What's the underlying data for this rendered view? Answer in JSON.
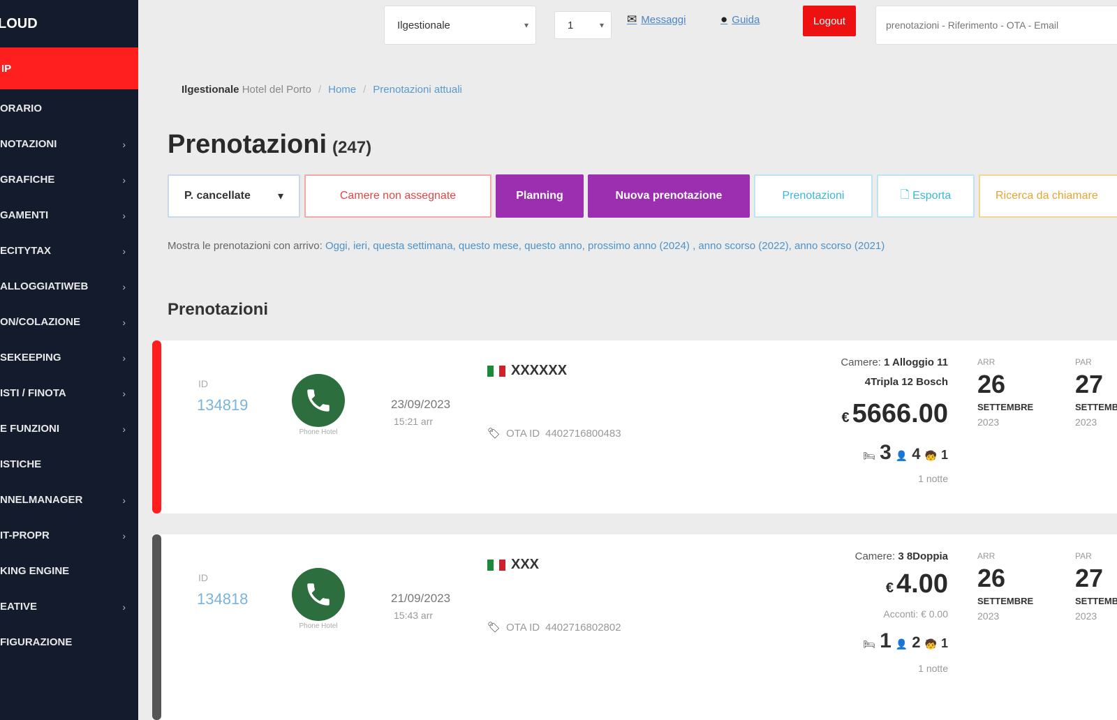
{
  "sidebar": {
    "brand": "LOUD",
    "active_item": "IP",
    "items": [
      {
        "label": "ORARIO",
        "chevron": false
      },
      {
        "label": "NOTAZIONI",
        "chevron": true
      },
      {
        "label": "GRAFICHE",
        "chevron": true
      },
      {
        "label": "GAMENTI",
        "chevron": true
      },
      {
        "label": "ECITYTAX",
        "chevron": true
      },
      {
        "label": "ALLOGGIATIWEB",
        "chevron": true
      },
      {
        "label": "ON/COLAZIONE",
        "chevron": true
      },
      {
        "label": "SEKEEPING",
        "chevron": true
      },
      {
        "label": "ISTI / FINOTA",
        "chevron": true
      },
      {
        "label": "E FUNZIONI",
        "chevron": true
      },
      {
        "label": "ISTICHE",
        "chevron": false
      },
      {
        "label": "NNELMANAGER",
        "chevron": true
      },
      {
        "label": "IT-PROPR",
        "chevron": true
      },
      {
        "label": "KING ENGINE",
        "chevron": false
      },
      {
        "label": "EATIVE",
        "chevron": true
      },
      {
        "label": "FIGURAZIONE",
        "chevron": false
      }
    ]
  },
  "topbar": {
    "hotel_select": "Ilgestionale",
    "lang_select": "1",
    "messages_link": "Messaggi",
    "help_link": "Guida",
    "logout": "Logout",
    "search_placeholder": "prenotazioni - Riferimento - OTA - Email"
  },
  "breadcrumb": {
    "hotel": "Ilgestionale",
    "hotel_sub": "Hotel del Porto",
    "home": "Home",
    "current": "Prenotazioni attuali"
  },
  "page": {
    "title": "Prenotazioni",
    "count": "(247)"
  },
  "toolbar": {
    "filter_select": "P. cancellate",
    "unassigned": "Camere non assegnate",
    "planning": "Planning",
    "new_booking": "Nuova prenotazione",
    "bookings": "Prenotazioni",
    "export": "Esporta",
    "next": "Ricerca da chiamare"
  },
  "filter_line": {
    "prefix": "Mostra le prenotazioni con arrivo:",
    "links": "Oggi, ieri, questa settimana, questo mese, questo anno, prossimo anno (2024) , anno scorso (2022), anno scorso (2021)"
  },
  "section_title": "Prenotazioni",
  "bookings": [
    {
      "id_label": "ID",
      "id": "134819",
      "phone_sub": "Phone Hotel",
      "date": "23/09/2023",
      "time": "15:21 arr",
      "guest": "XXXXXX",
      "ota_label": "OTA ID",
      "ota_id": "4402716800483",
      "room_label": "Camere:",
      "room_line1": "1 Alloggio 11",
      "room_line2": "4Tripla 12 Bosch",
      "currency": "€",
      "price": "5666.00",
      "paid": "",
      "adults": "3",
      "children": "4",
      "infants": "1",
      "nights": "1 notte",
      "arrival_label": "ARR",
      "arrival_day": "26",
      "arrival_month": "SETTEMBRE",
      "arrival_year": "2023",
      "departure_label": "PAR",
      "departure_day": "27",
      "departure_month": "SETTEMBRE",
      "departure_year": "2023",
      "edge_color": "#ff1e1e"
    },
    {
      "id_label": "ID",
      "id": "134818",
      "phone_sub": "Phone Hotel",
      "date": "21/09/2023",
      "time": "15:43 arr",
      "guest": "XXX",
      "ota_label": "OTA ID",
      "ota_id": "4402716802802",
      "room_label": "Camere:",
      "room_line1": "3 8Doppia",
      "room_line2": "",
      "currency": "€",
      "price": "4.00",
      "paid": "Acconti: € 0.00",
      "adults": "1",
      "children": "2",
      "infants": "1",
      "nights": "1 notte",
      "arrival_label": "ARR",
      "arrival_day": "26",
      "arrival_month": "SETTEMBRE",
      "arrival_year": "2023",
      "departure_label": "PAR",
      "departure_day": "27",
      "departure_month": "SETTEMBRE",
      "departure_year": "2023",
      "edge_color": "#555555"
    }
  ]
}
